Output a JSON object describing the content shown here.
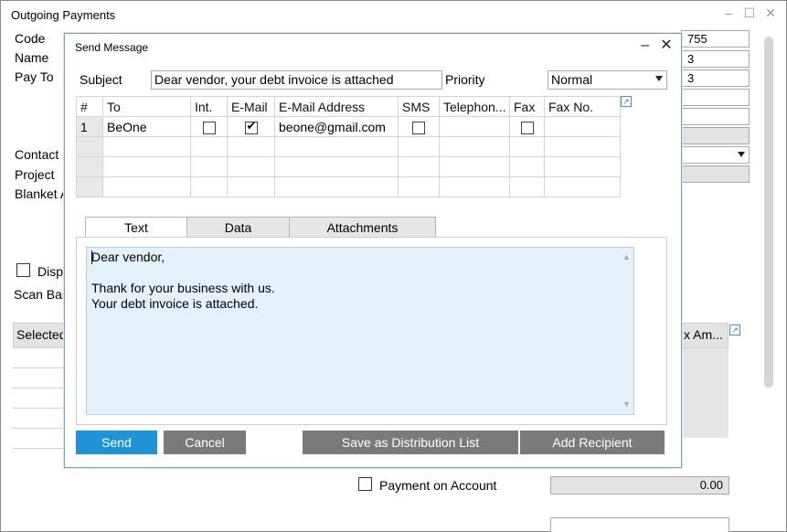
{
  "background": {
    "title": "Outgoing Payments",
    "labels": {
      "code": "Code",
      "name": "Name",
      "pay_to": "Pay To",
      "contact": "Contact",
      "project": "Project",
      "blanket": "Blanket A",
      "display": "Displ",
      "scan_bar": "Scan Bar",
      "selected": "Selected",
      "tax_amount": "x Am...",
      "payment_on_account": "Payment on Account"
    },
    "fields": {
      "code_value": "755",
      "name_value": "3",
      "pay_to_value": "3",
      "payment_on_account_value": "0.00"
    }
  },
  "dialog": {
    "title": "Send Message",
    "subject_label": "Subject",
    "subject_value": "Dear vendor, your debt invoice is attached",
    "priority_label": "Priority",
    "priority_value": "Normal",
    "grid": {
      "columns": [
        "#",
        "To",
        "Int.",
        "E-Mail",
        "E-Mail Address",
        "SMS",
        "Telephon...",
        "Fax",
        "Fax No."
      ],
      "rows": [
        {
          "num": "1",
          "to": "BeOne",
          "int": false,
          "email": true,
          "email_address": "beone@gmail.com",
          "sms": false,
          "telephone": "",
          "fax": false,
          "fax_no": ""
        }
      ]
    },
    "tabs": {
      "text": "Text",
      "data": "Data",
      "attachments": "Attachments"
    },
    "message": {
      "line1": "Dear vendor,",
      "line2": "",
      "line3": "Thank for your business with us.",
      "line4": "Your debt invoice is attached."
    },
    "buttons": {
      "send": "Send",
      "cancel": "Cancel",
      "save_distribution": "Save as Distribution List",
      "add_recipient": "Add Recipient"
    },
    "colors": {
      "primary_button": "#1f93d8",
      "secondary_button": "#7a7a7a",
      "message_area": "#e4f1fb"
    }
  }
}
